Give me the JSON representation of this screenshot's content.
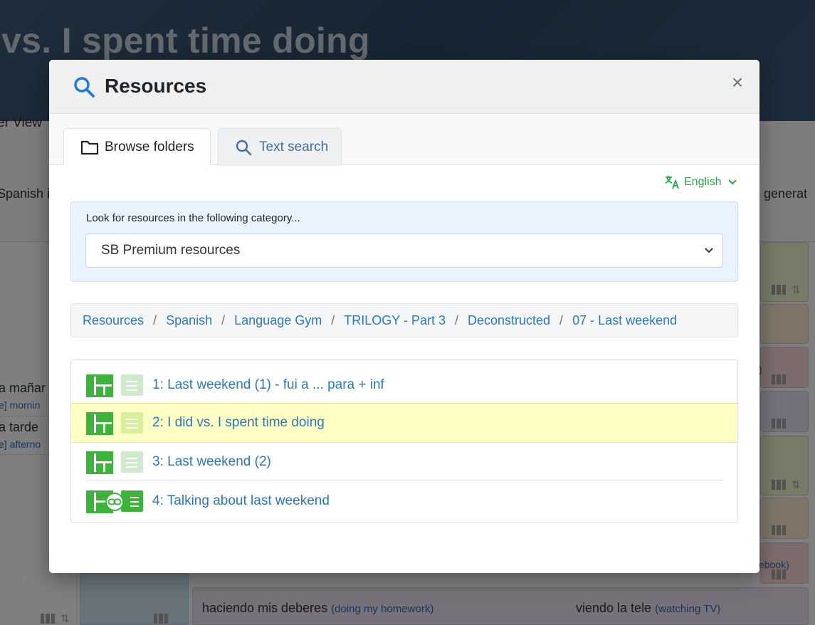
{
  "background": {
    "hero_title": "vs. I spent time doing",
    "view_tab": "er View",
    "intro_left": "Spanish i",
    "intro_right": "o generat",
    "phrases": [
      {
        "text": "a mañar",
        "translation": "e] mornin"
      },
      {
        "text": "a tarde",
        "translation": "e] afterno"
      }
    ],
    "bottom_left_phrase": "haciendo mis deberes",
    "bottom_left_translation": "(doing my homework)",
    "bottom_right_phrase": "viendo la tele",
    "bottom_right_translation": "(watching TV)",
    "right_fragment_1": ")",
    "right_fragment_2": "ebook)"
  },
  "modal": {
    "title": "Resources",
    "title_icon": "search-icon",
    "close_label": "×",
    "tabs": [
      {
        "label": "Browse folders",
        "icon": "folder-icon",
        "active": true
      },
      {
        "label": "Text search",
        "icon": "search-icon",
        "active": false
      }
    ],
    "language": {
      "label": "English",
      "icon": "translate-icon"
    },
    "category": {
      "prompt": "Look for resources in the following category...",
      "selected": "SB Premium resources"
    },
    "breadcrumb": [
      "Resources",
      "Spanish",
      "Language Gym",
      "TRILOGY - Part 3",
      "Deconstructed",
      "07 - Last weekend"
    ],
    "items": [
      {
        "label": "1: Last weekend (1) - fui a ... para + inf",
        "highlighted": false,
        "linked": false
      },
      {
        "label": "2: I did vs. I spent time doing",
        "highlighted": true,
        "linked": false
      },
      {
        "label": "3: Last weekend (2)",
        "highlighted": false,
        "linked": false
      },
      {
        "label": "4: Talking about last weekend",
        "highlighted": false,
        "linked": true
      }
    ]
  },
  "colors": {
    "accent": "#2a78c2",
    "green": "#3cb43c",
    "highlight": "#ffffc4",
    "category_bg": "#e9f3fe"
  }
}
